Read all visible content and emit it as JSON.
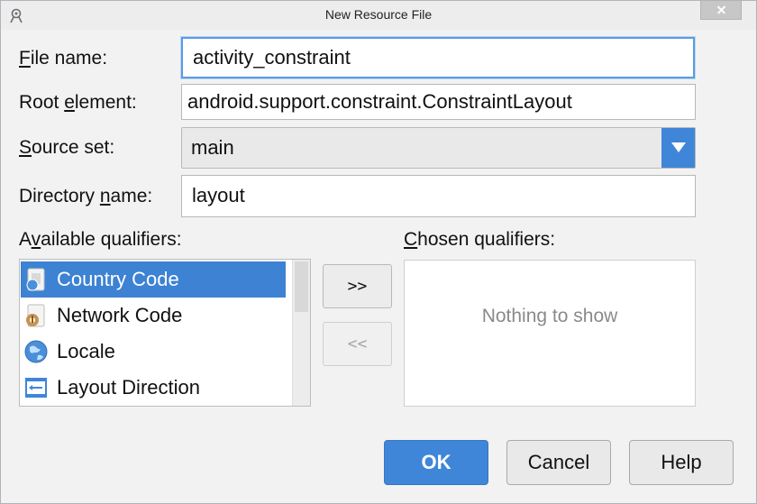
{
  "window": {
    "title": "New Resource File",
    "app_icon": "android-studio-icon",
    "close_icon": "close-icon"
  },
  "form": {
    "file_name": {
      "label_underline": "F",
      "label_rest": "ile name:",
      "value": "activity_constraint"
    },
    "root_element": {
      "label_pre": "Root ",
      "label_underline": "e",
      "label_rest": "lement:",
      "value": "android.support.constraint.ConstraintLayout"
    },
    "source_set": {
      "label_underline": "S",
      "label_rest": "ource set:",
      "value": "main"
    },
    "directory_name": {
      "label_pre": "Directory ",
      "label_underline": "n",
      "label_rest": "ame:",
      "value": "layout"
    }
  },
  "available": {
    "label_pre": "A",
    "label_underline": "v",
    "label_rest": "ailable qualifiers:",
    "items": [
      {
        "label": "Country Code",
        "icon": "country-code-icon",
        "selected": true
      },
      {
        "label": "Network Code",
        "icon": "network-code-icon",
        "selected": false
      },
      {
        "label": "Locale",
        "icon": "globe-icon",
        "selected": false
      },
      {
        "label": "Layout Direction",
        "icon": "layout-direction-icon",
        "selected": false
      }
    ]
  },
  "chosen": {
    "label_underline": "C",
    "label_rest": "hosen qualifiers:",
    "empty_text": "Nothing to show"
  },
  "move": {
    "add_label": ">>",
    "remove_label": "<<"
  },
  "buttons": {
    "ok": "OK",
    "cancel": "Cancel",
    "help": "Help"
  },
  "colors": {
    "accent": "#3f86d8",
    "selection": "#3d82d3",
    "focus": "#5a9be3"
  }
}
